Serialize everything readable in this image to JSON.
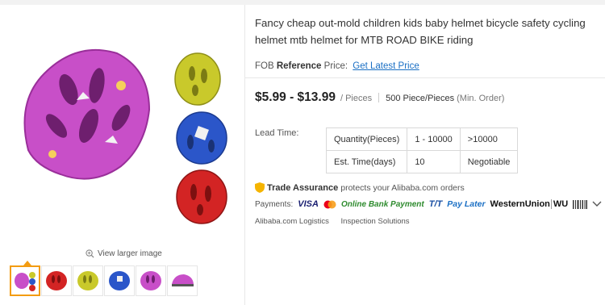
{
  "gallery": {
    "view_larger": "View larger image",
    "thumbnails": [
      "pink-helmet-set",
      "red-helmet",
      "yellow-helmet",
      "blue-helmet",
      "pink-helmet",
      "pink-helmet-side"
    ]
  },
  "product": {
    "title": "Fancy cheap out-mold children kids baby helmet bicycle safety cycling helmet mtb helmet for MTB ROAD BIKE riding",
    "ref_prefix": "FOB",
    "ref_bold": "Reference",
    "ref_suffix": "Price:",
    "ref_link": "Get Latest Price"
  },
  "pricing": {
    "amount": "$5.99 - $13.99",
    "unit": "/ Pieces",
    "moq": "500 Piece/Pieces",
    "moq_note": "(Min. Order)"
  },
  "lead_time": {
    "label": "Lead Time:",
    "rows": [
      [
        "Quantity(Pieces)",
        "1 - 10000",
        ">10000"
      ],
      [
        "Est. Time(days)",
        "10",
        "Negotiable"
      ]
    ]
  },
  "trade": {
    "title": "Trade Assurance",
    "text": "protects your Alibaba.com orders"
  },
  "payments": {
    "label": "Payments:",
    "methods": [
      "VISA",
      "Online Bank Payment",
      "T/T",
      "Pay Later",
      "WesternUnion",
      "WU"
    ]
  },
  "services": [
    "Alibaba.com Logistics",
    "Inspection Solutions"
  ],
  "colors": {
    "pink": "#c84fc8",
    "yellow": "#c9c92b",
    "blue": "#2b56c9",
    "red": "#d32424",
    "accent": "#f39c12",
    "link": "#1a6fc4"
  }
}
